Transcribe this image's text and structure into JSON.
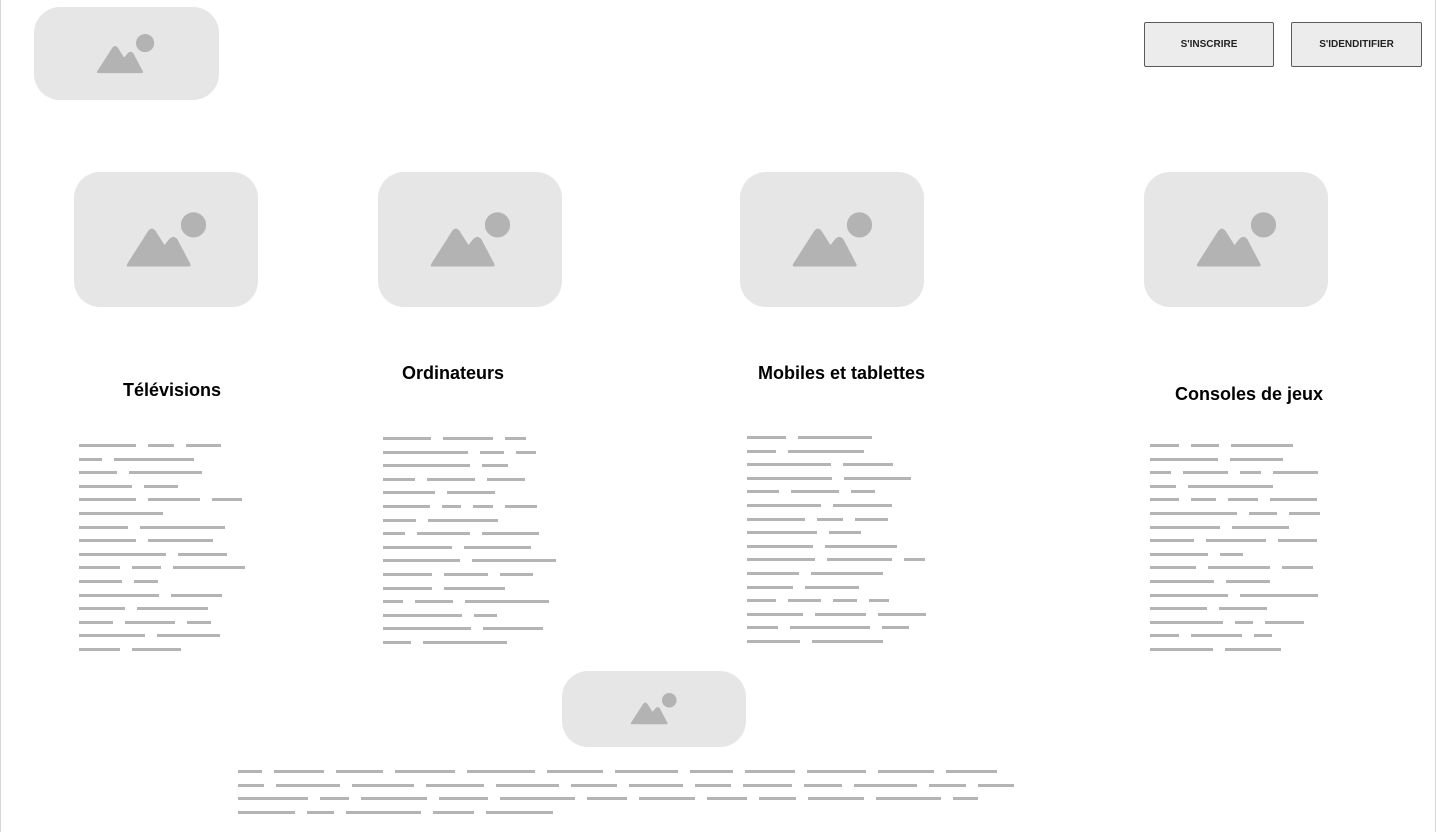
{
  "header": {
    "logo_icon": "image-placeholder-icon",
    "buttons": {
      "register_label": "S'INSCRIRE",
      "login_label": "S'IDENDITIFIER"
    }
  },
  "categories": [
    {
      "title": "Télévisions",
      "image_icon": "image-placeholder-icon"
    },
    {
      "title": "Ordinateurs",
      "image_icon": "image-placeholder-icon"
    },
    {
      "title": "Mobiles et tablettes",
      "image_icon": "image-placeholder-icon"
    },
    {
      "title": "Consoles de jeux",
      "image_icon": "image-placeholder-icon"
    }
  ],
  "footer": {
    "image_icon": "image-placeholder-icon"
  },
  "colors": {
    "placeholder_bg": "#e6e6e6",
    "placeholder_icon": "#b3b3b3",
    "button_bg": "#ececec",
    "button_border": "#5a5a5a",
    "text_placeholder": "#b4b4b4"
  }
}
